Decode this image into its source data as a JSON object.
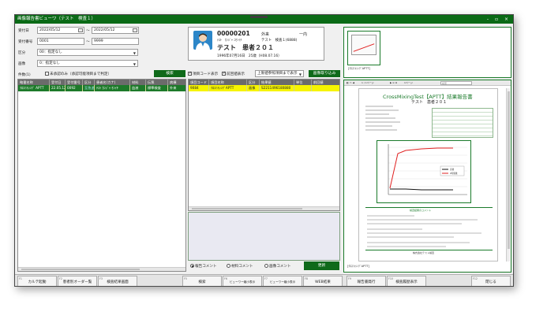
{
  "window": {
    "title": "画像報告書ビューワ（テスト　検査１）",
    "controls": "- ▫ ×"
  },
  "search": {
    "date_label": "受付日",
    "date_from": "2022/05/12",
    "date_sep": "～",
    "date_to": "2022/05/12",
    "number_label": "受付番号",
    "number_from": "0001",
    "number_sep": "～",
    "number_to": "9999",
    "category_label": "区分",
    "category_value": "00：指定なし",
    "image_label": "画像",
    "image_value": "0：指定なし",
    "count_label": "件数(1)",
    "unconfirmed_label": "未承認のみ（承認可能項目まで判定）",
    "search_button": "検索"
  },
  "left_table": {
    "headers": [
      "略番名称",
      "受付日",
      "受付番号",
      "区分",
      "患者名(カナ)",
      "材料",
      "伝票",
      "病棟"
    ],
    "rows": [
      [
        "ｸﾛｽﾐｷｼﾝｸﾞ APTT",
        "22.05.12",
        "0092",
        "至急追",
        "ﾃｽﾄ ｶﾝｼﾞｬ ｾﾝｲﾁ",
        "血液",
        "標準検査",
        "外来"
      ]
    ]
  },
  "patient": {
    "id": "00000201",
    "ward": "外来",
    "dept": "一内",
    "kana": "ﾃｽﾄ　ｶﾝｼﾞｬ ﾆｾﾝｲﾁ",
    "doctor": "テスト　検査１(6888)",
    "name": "テスト　患者２０１",
    "birth": "1996年07月16日　25歳（H08.07.16）"
  },
  "options": {
    "code_display": "項目コード表示",
    "prev_value": "前回値表示",
    "ref_select": "上限値参照項目まで表示",
    "image_button": "画像取り込み"
  },
  "item_table": {
    "headers": [
      "項目コード",
      "項目名称",
      "区分",
      "結果値",
      "単位",
      "前回値"
    ],
    "rows": [
      [
        "9084",
        "ｸﾛｽﾐｷｼﾝｸﾞAPTT",
        "画像",
        "S2211496180880",
        "",
        ""
      ]
    ]
  },
  "comments": {
    "report": "報告コメント",
    "material": "材料コメント",
    "image": "画像コメント",
    "update_button": "更新"
  },
  "thumbnail": {
    "caption": "[ｸﾛｽﾐｷｼﾝｸﾞAPTT]"
  },
  "viewer": {
    "page_label": "1 / 1ページ",
    "zoom_label": "1ページ",
    "search_placeholder": "検索",
    "caption": "[ｸﾛｽﾐｷｼﾝｸﾞAPTT]"
  },
  "report": {
    "title": "CrossMixingTest【APTT】結果報告書",
    "patient_line": "テスト　患者２０１",
    "legend": [
      "直後",
      "2時間後"
    ],
    "footer_heading": "検査結果のコメント",
    "footer_company": "株式会社テスト検査",
    "colors": {
      "line_immediate": "#111111",
      "line_2h": "#e02020",
      "accent": "#1a7a2a"
    }
  },
  "footer": {
    "buttons": [
      {
        "fkey": "F1",
        "label": "カルテ起動"
      },
      {
        "fkey": "F2",
        "label": "患者別オーダー覧"
      },
      {
        "fkey": "F3",
        "label": "検査結果画面"
      },
      {
        "fkey": "F5",
        "label": "検索"
      },
      {
        "fkey": "F6",
        "label": "ビューワー縮小表示"
      },
      {
        "fkey": "F7",
        "label": "ビューワー縮小表示"
      },
      {
        "fkey": "F8",
        "label": "WEB結果"
      },
      {
        "fkey": "F9",
        "label": "報告書発行"
      },
      {
        "fkey": "F10",
        "label": "検査履歴表示"
      },
      {
        "fkey": "F12",
        "label": "閉じる"
      }
    ]
  }
}
